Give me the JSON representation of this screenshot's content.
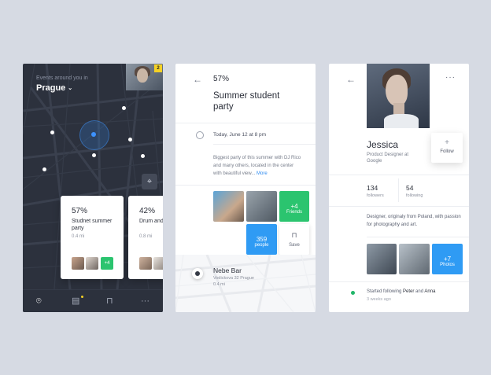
{
  "colors": {
    "background": "#d6dae3",
    "map_dark": "#2c313d",
    "green": "#2bc46f",
    "blue": "#2f8cf0",
    "yellow": "#f4d125"
  },
  "map_screen": {
    "events_label": "Events around you in",
    "city": "Prague",
    "notification_count": "2",
    "cards": [
      {
        "percent": "57%",
        "title": "Studnet summer party",
        "distance": "0.4 mi",
        "more": "+4"
      },
      {
        "percent": "42%",
        "title": "Drum and productio",
        "distance": "0.8 mi"
      }
    ],
    "nav_icons": [
      "location-pin-icon",
      "list-icon",
      "bookmark-icon",
      "more-icon"
    ]
  },
  "detail_screen": {
    "percent": "57%",
    "title": "Summer student party",
    "date": "Today, June 12 at 8 pm",
    "description": "Biggest party of this summer with DJ Rico and many others, located in the center with beautiful view...",
    "more_link": "More",
    "friends_count": "+4",
    "friends_label": "Friends",
    "people_count": "359",
    "people_label": "people",
    "save_label": "Save",
    "venue_name": "Nebe Bar",
    "venue_address": "Vodickova 32 Prague",
    "venue_distance": "0.4 mi"
  },
  "profile_screen": {
    "name": "Jessica",
    "job": "Product Designer at Google",
    "follow_label": "Follow",
    "followers_count": "134",
    "followers_label": "followers",
    "following_count": "54",
    "following_label": "following",
    "bio": "Designer, originaly from Poland, with passion for photography and art.",
    "photos_count": "+7",
    "photos_label": "Photos",
    "activity_prefix": "Started following",
    "activity_user1": "Peter",
    "activity_and": "and",
    "activity_user2": "Anna",
    "activity_time": "3 weeks ago"
  }
}
